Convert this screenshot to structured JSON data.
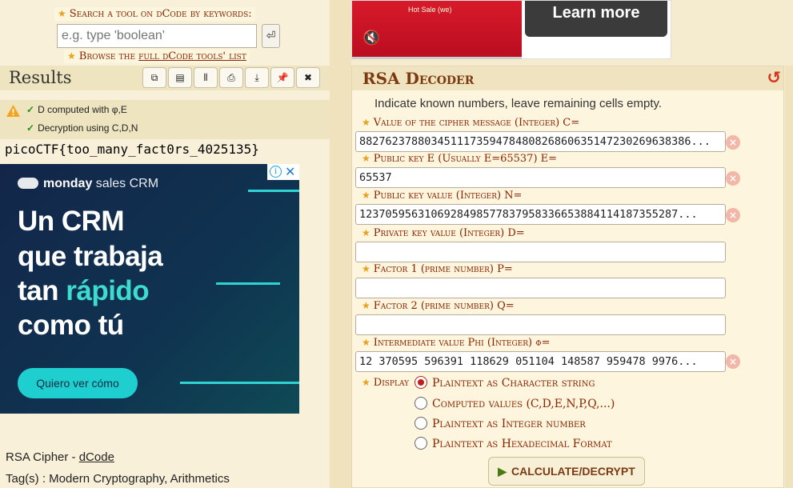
{
  "search": {
    "label": "Search a tool on dCode by keywords:",
    "placeholder": "e.g. type 'boolean'",
    "go_icon": "enter-icon",
    "go_glyph": "⏎"
  },
  "browse": {
    "prefix": "Browse the ",
    "link": "full dCode tools' list"
  },
  "results": {
    "title": "Results",
    "toolbar_icons": [
      "copy-icon",
      "clipboard-icon",
      "columns-icon",
      "print-icon",
      "download-icon",
      "pin-icon",
      "close-icon"
    ],
    "toolbar_glyphs": [
      "⧉",
      "▤",
      "⦀",
      "⎙",
      "⤓",
      "📌",
      "✖"
    ],
    "lines": [
      "D computed with φ,E",
      "Decryption using C,D,N"
    ],
    "output": "picoCTF{too_many_fact0rs_4025135}"
  },
  "ad_left": {
    "brand_bold": "monday",
    "brand_rest": " sales CRM",
    "headline": [
      "Un CRM",
      "que trabaja",
      "tan ",
      "rápido",
      "como tú"
    ],
    "cta": "Quiero ver cómo",
    "info_glyph": "i",
    "close_glyph": "✕"
  },
  "footer": {
    "line1_prefix": "RSA Cipher - ",
    "line1_link": "dCode",
    "line2": "Tag(s) : Modern Cryptography, Arithmetics"
  },
  "ad_right": {
    "video_text": "Hot Sale (we)",
    "learn_more": "Learn more",
    "mute_glyph": "🔇"
  },
  "rsa": {
    "title": "RSA Decoder",
    "reset_glyph": "↺",
    "intro": "Indicate known numbers, leave remaining cells empty.",
    "fields": [
      {
        "label": "Value of the cipher message (Integer) C=",
        "value": "882762378803451117359478480826860635147230269638386...",
        "has_clear": true
      },
      {
        "label": "Public key E (Usually E=65537) E=",
        "value": "65537",
        "has_clear": true
      },
      {
        "label": "Public key value (Integer) N=",
        "value": "1237059563106928498577837958336653884114187355287...",
        "has_clear": true
      },
      {
        "label": "Private key value (Integer) D=",
        "value": "",
        "has_clear": false
      },
      {
        "label": "Factor 1 (prime number) P=",
        "value": "",
        "has_clear": false
      },
      {
        "label": "Factor 2 (prime number) Q=",
        "value": "",
        "has_clear": false
      },
      {
        "label": "Intermediate value Phi (Integer) φ=",
        "value": "12 370595 596391 118629 051104 148587 959478 9976...",
        "has_clear": true
      }
    ],
    "clear_glyph": "×",
    "display_label": "Display",
    "display_options": [
      {
        "label": "Plaintext as Character string",
        "selected": true
      },
      {
        "label": "Computed values (C,D,E,N,P,Q,...)",
        "selected": false
      },
      {
        "label": "Plaintext as Integer number",
        "selected": false
      },
      {
        "label": "Plaintext as Hexadecimal Format",
        "selected": false
      }
    ],
    "calculate": "CALCULATE/DECRYPT"
  }
}
